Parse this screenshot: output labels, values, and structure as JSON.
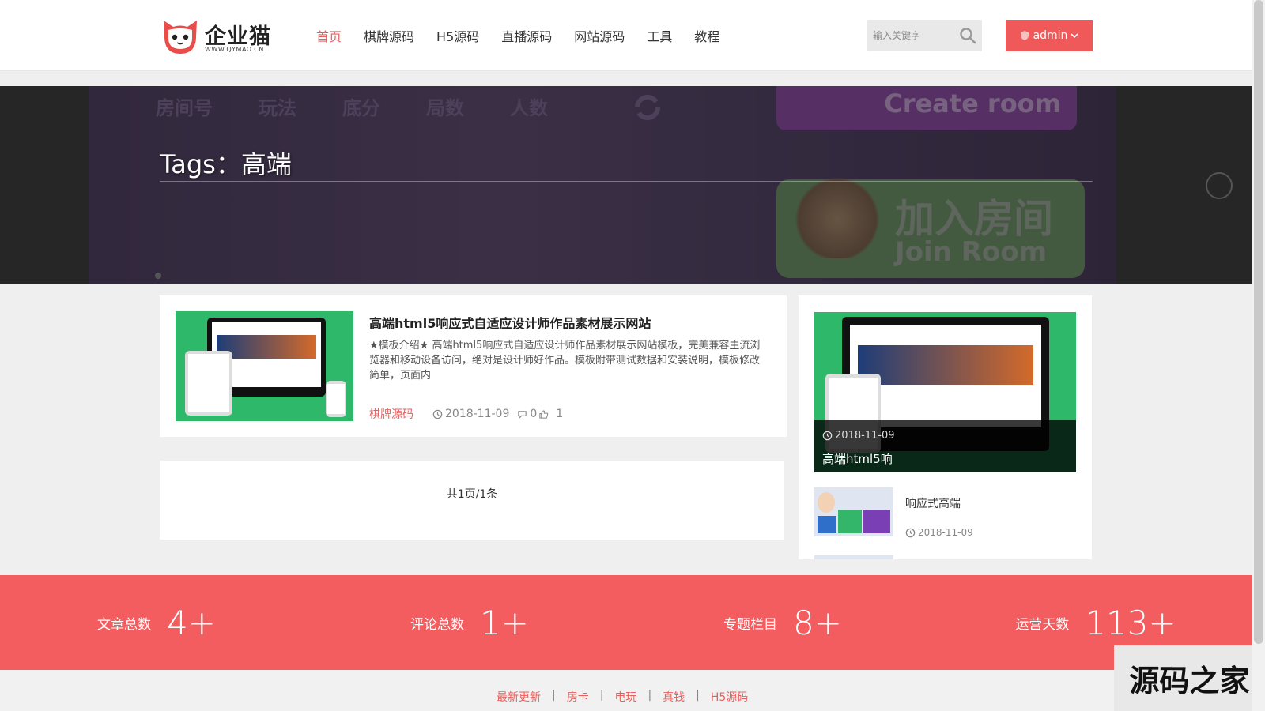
{
  "header": {
    "logo_text": "企业猫",
    "logo_url": "WWW.QYMAO.CN",
    "nav": [
      {
        "label": "首页",
        "active": true
      },
      {
        "label": "棋牌源码",
        "active": false
      },
      {
        "label": "H5源码",
        "active": false
      },
      {
        "label": "直播源码",
        "active": false
      },
      {
        "label": "网站源码",
        "active": false
      },
      {
        "label": "工具",
        "active": false
      },
      {
        "label": "教程",
        "active": false
      }
    ],
    "search_placeholder": "输入关键字",
    "user_label": "admin"
  },
  "banner": {
    "title": "Tags：高端",
    "bg_headers": [
      "房间号",
      "玩法",
      "底分",
      "局数",
      "人数"
    ],
    "create_text": "Create room",
    "join_title": "加入房间",
    "join_sub": "Join Room"
  },
  "article": {
    "title": "高端html5响应式自适应设计师作品素材展示网站",
    "desc": "★模板介绍★ 高端html5响应式自适应设计师作品素材展示网站模板，完美兼容主流浏览器和移动设备访问，绝对是设计师好作品。模板附带测试数据和安装说明，模板修改简单，页面内",
    "category": "棋牌源码",
    "date": "2018-11-09",
    "comments": "0",
    "likes": "1"
  },
  "pagination": {
    "text": "共1页/1条"
  },
  "sidebar": {
    "feature": {
      "date": "2018-11-09",
      "title": "高端html5响"
    },
    "items": [
      {
        "title": "响应式高端",
        "date": "2018-11-09"
      }
    ]
  },
  "stats": [
    {
      "label": "文章总数",
      "value": "4+"
    },
    {
      "label": "评论总数",
      "value": "1+"
    },
    {
      "label": "专题栏目",
      "value": "8+"
    },
    {
      "label": "运营天数",
      "value": "113+"
    }
  ],
  "footer": {
    "links": [
      "最新更新",
      "房卡",
      "电玩",
      "真钱",
      "H5源码"
    ],
    "separator": "|"
  },
  "watermark": "源码之家",
  "colors": {
    "accent": "#e8605d",
    "stats_bg": "#f35d5f",
    "thumb_green": "#2db86a"
  },
  "icons": {
    "search": "search-icon",
    "user": "shield-icon",
    "clock": "clock-icon",
    "comment": "comment-icon",
    "like": "thumbs-up-icon"
  }
}
